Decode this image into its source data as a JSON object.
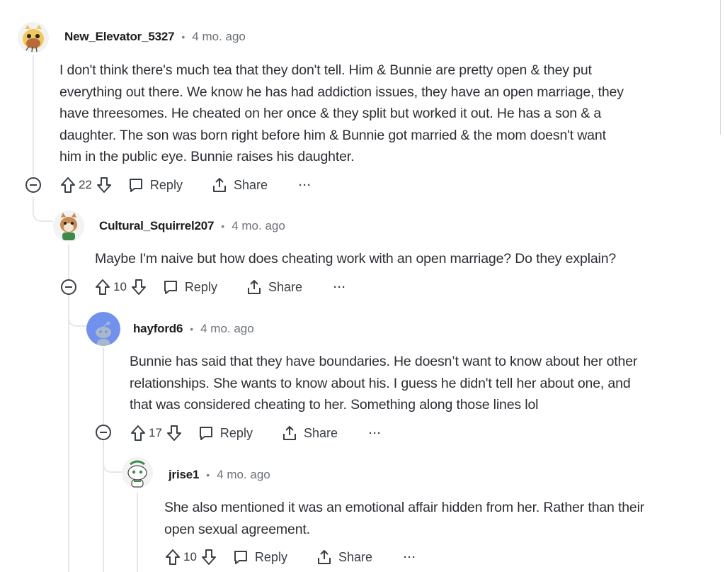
{
  "comments": [
    {
      "author": "New_Elevator_5327",
      "time": "4 mo. ago",
      "body_lines": [
        "I don't think there's much tea that they don't tell. Him & Bunnie are pretty open & they put",
        "everything out there. We know he has had addiction issues, they have an open marriage, they",
        "have threesomes. He cheated on her once & they split but worked it out. He has a son & a",
        "daughter. The son was born right before him & Bunnie got married & the mom doesn't want",
        "him in the public eye. Bunnie raises his daughter."
      ],
      "votes": "22",
      "reply_label": "Reply",
      "share_label": "Share",
      "more_label": "···",
      "avatar": "cartoon-avatar-icon"
    },
    {
      "author": "Cultural_Squirrel207",
      "time": "4 mo. ago",
      "body_lines": [
        "Maybe I'm naive but how does cheating work with an open marriage? Do they explain?"
      ],
      "votes": "10",
      "reply_label": "Reply",
      "share_label": "Share",
      "more_label": "···",
      "avatar": "squirrel-avatar-icon"
    },
    {
      "author": "hayford6",
      "time": "4 mo. ago",
      "body_lines": [
        "Bunnie has said that they have boundaries. He doesn’t want to know about her other",
        "relationships. She wants to know about his. I guess he didn't tell her about one, and",
        "that was considered cheating to her. Something along those lines lol"
      ],
      "votes": "17",
      "reply_label": "Reply",
      "share_label": "Share",
      "more_label": "···",
      "avatar": "default-snoo-avatar-icon"
    },
    {
      "author": "jrise1",
      "time": "4 mo. ago",
      "body_lines": [
        "She also mentioned it was an emotional affair hidden from her. Rather than their",
        "open sexual agreement."
      ],
      "votes": "10",
      "reply_label": "Reply",
      "share_label": "Share",
      "more_label": "···",
      "avatar": "snoo-avatar-icon"
    }
  ],
  "meta_separator": "•",
  "colors": {
    "thread_line": "#e5e7eb",
    "text": "#2b2e33",
    "muted": "#6b7178",
    "snoo_blue": "#6e8df0"
  }
}
